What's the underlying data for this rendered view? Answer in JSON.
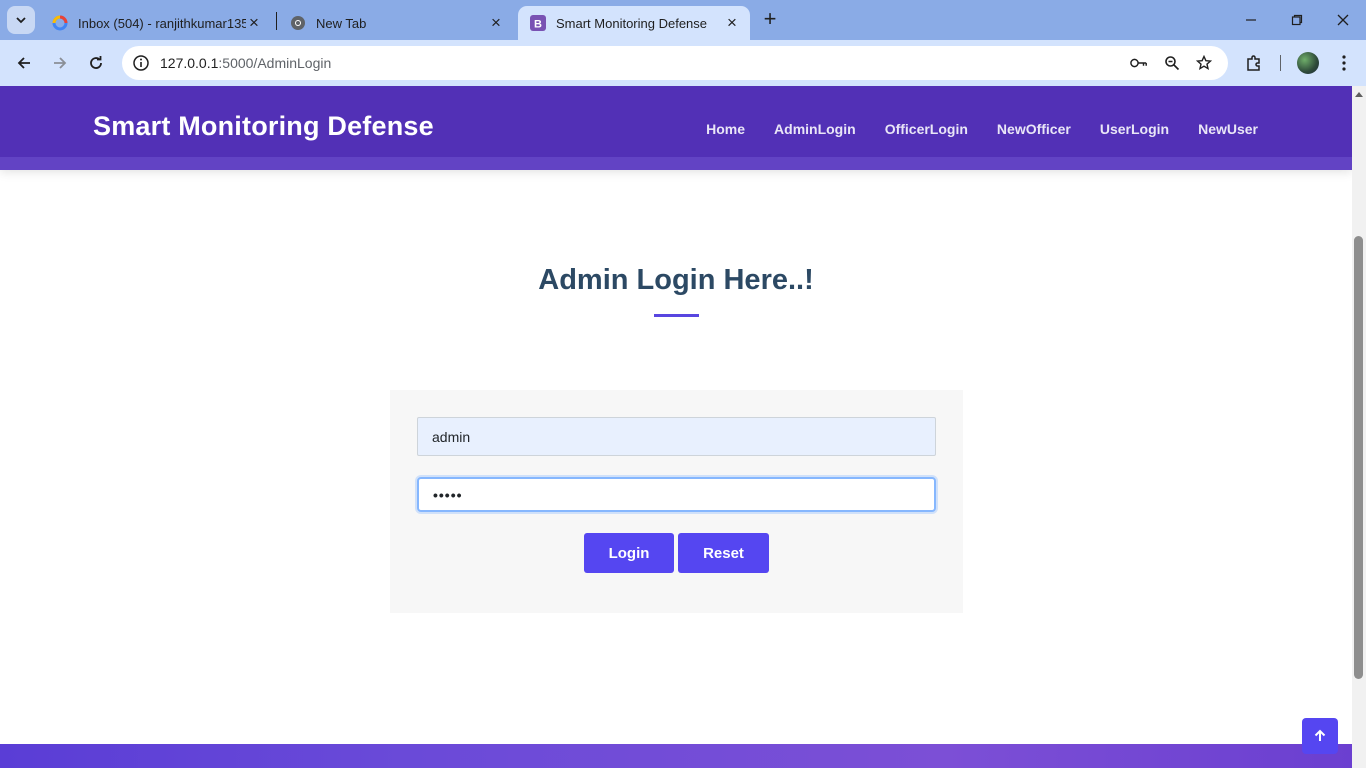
{
  "browser": {
    "tabs": [
      {
        "title": "Inbox (504) - ranjithkumar1357…",
        "icon": "gmail-icon"
      },
      {
        "title": "New Tab",
        "icon": "chrome-icon"
      },
      {
        "title": "Smart Monitoring Defense",
        "icon": "bootstrap-icon",
        "active": true
      }
    ],
    "url_host": "127.0.0.1",
    "url_path": ":5000/AdminLogin"
  },
  "site": {
    "brand": "Smart Monitoring Defense",
    "nav": [
      "Home",
      "AdminLogin",
      "OfficerLogin",
      "NewOfficer",
      "UserLogin",
      "NewUser"
    ],
    "accent_color": "#5546f1",
    "header_color": "#5230b6"
  },
  "login": {
    "title": "Admin Login Here..!",
    "username_value": "admin",
    "password_value": "•••••",
    "login_label": "Login",
    "reset_label": "Reset"
  }
}
